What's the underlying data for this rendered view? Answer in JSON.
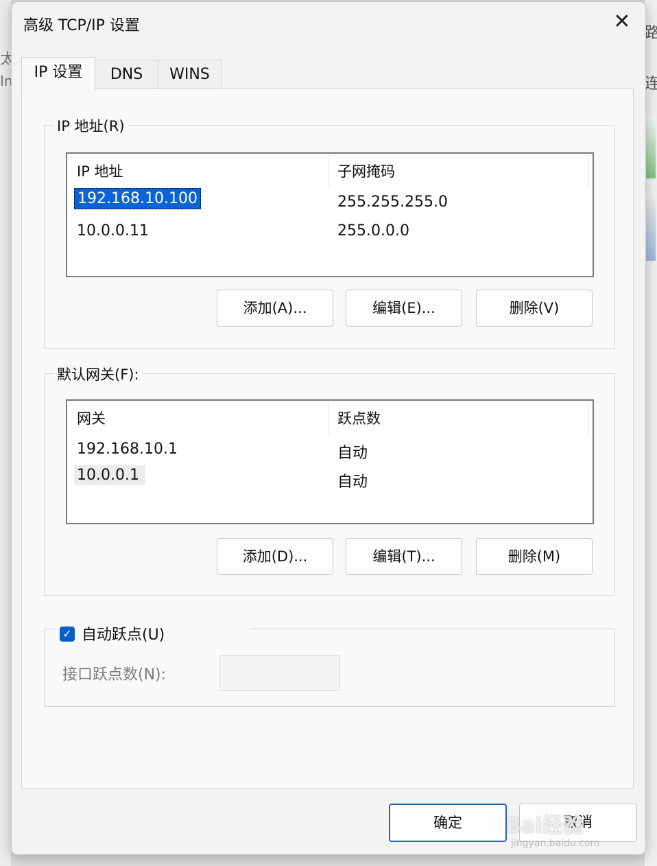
{
  "background": {
    "left_fragments": [
      "太",
      "In"
    ],
    "right_fragments": [
      "路",
      "连"
    ]
  },
  "dialog": {
    "title": "高级 TCP/IP 设置",
    "close_glyph": "✕"
  },
  "tabs": [
    {
      "label": "IP 设置",
      "active": true
    },
    {
      "label": "DNS",
      "active": false
    },
    {
      "label": "WINS",
      "active": false
    }
  ],
  "ip_section": {
    "group_label": "IP 地址(R)",
    "columns": [
      "IP 地址",
      "子网掩码"
    ],
    "rows": [
      {
        "ip": "192.168.10.100",
        "mask": "255.255.255.0"
      },
      {
        "ip": "10.0.0.11",
        "mask": "255.0.0.0"
      }
    ],
    "buttons": {
      "add": "添加(A)...",
      "edit": "编辑(E)...",
      "delete": "删除(V)"
    }
  },
  "gateway_section": {
    "group_label": "默认网关(F):",
    "columns": [
      "网关",
      "跃点数"
    ],
    "rows": [
      {
        "gateway": "192.168.10.1",
        "metric": "自动"
      },
      {
        "gateway": "10.0.0.1",
        "metric": "自动"
      }
    ],
    "buttons": {
      "add": "添加(D)...",
      "edit": "编辑(T)...",
      "delete": "删除(M)"
    }
  },
  "metric_section": {
    "auto_metric_label": "自动跃点(U)",
    "auto_metric_checked": true,
    "check_glyph": "✓",
    "interface_metric_label": "接口跃点数(N):",
    "interface_metric_value": ""
  },
  "footer": {
    "ok": "确定",
    "cancel": "取消"
  },
  "watermark": {
    "brand": "Bai经验",
    "url": "jingyan.baidu.com"
  }
}
